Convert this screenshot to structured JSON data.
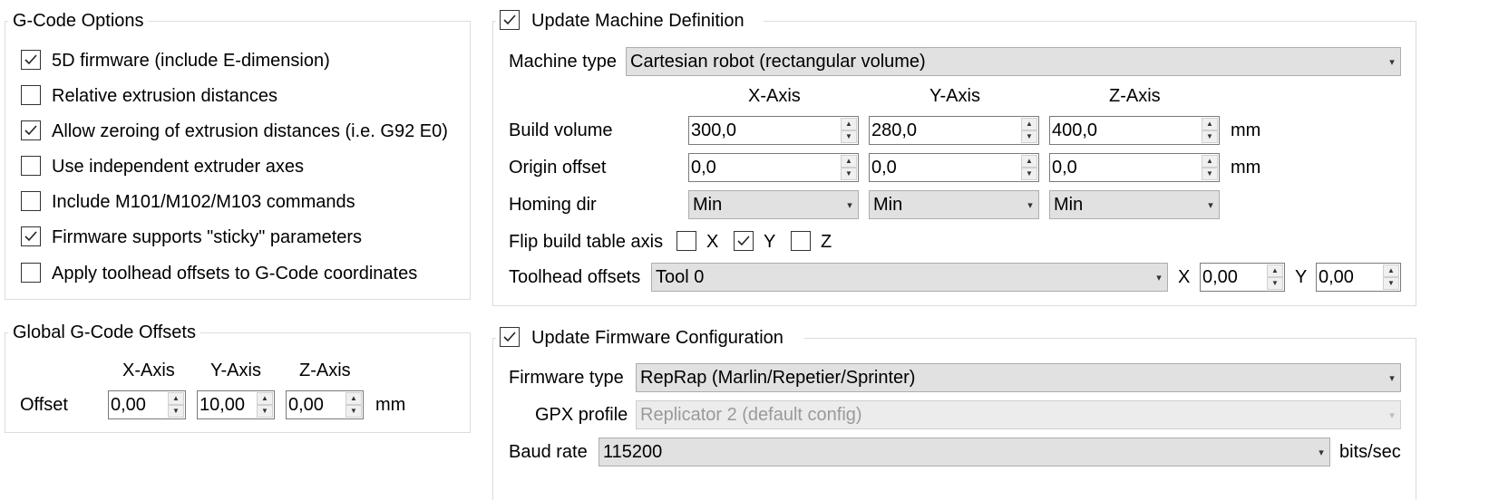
{
  "gcode_options": {
    "title": "G-Code Options",
    "items": [
      {
        "label": "5D firmware (include E-dimension)",
        "checked": true
      },
      {
        "label": "Relative extrusion distances",
        "checked": false
      },
      {
        "label": "Allow zeroing of extrusion distances (i.e. G92 E0)",
        "checked": true
      },
      {
        "label": "Use independent extruder axes",
        "checked": false
      },
      {
        "label": "Include M101/M102/M103 commands",
        "checked": false
      },
      {
        "label": "Firmware supports \"sticky\" parameters",
        "checked": true
      },
      {
        "label": "Apply toolhead offsets to G-Code coordinates",
        "checked": false
      }
    ]
  },
  "global_offsets": {
    "title": "Global G-Code Offsets",
    "x_header": "X-Axis",
    "y_header": "Y-Axis",
    "z_header": "Z-Axis",
    "offset_label": "Offset",
    "x": "0,00",
    "y": "10,00",
    "z": "0,00",
    "unit": "mm"
  },
  "machine_def": {
    "title": "Update Machine Definition",
    "enabled": true,
    "machine_type_label": "Machine type",
    "machine_type_value": "Cartesian robot (rectangular volume)",
    "x_header": "X-Axis",
    "y_header": "Y-Axis",
    "z_header": "Z-Axis",
    "build_volume_label": "Build volume",
    "build_volume": {
      "x": "300,0",
      "y": "280,0",
      "z": "400,0"
    },
    "origin_offset_label": "Origin offset",
    "origin_offset": {
      "x": "0,0",
      "y": "0,0",
      "z": "0,0"
    },
    "unit": "mm",
    "homing_label": "Homing dir",
    "homing": {
      "x": "Min",
      "y": "Min",
      "z": "Min"
    },
    "flip_label": "Flip build table axis",
    "flip": {
      "x": {
        "label": "X",
        "checked": false
      },
      "y": {
        "label": "Y",
        "checked": true
      },
      "z": {
        "label": "Z",
        "checked": false
      }
    },
    "toolhead_label": "Toolhead offsets",
    "toolhead_value": "Tool 0",
    "toolhead_x_label": "X",
    "toolhead_x": "0,00",
    "toolhead_y_label": "Y",
    "toolhead_y": "0,00"
  },
  "firmware_config": {
    "title": "Update Firmware Configuration",
    "enabled": true,
    "firmware_type_label": "Firmware type",
    "firmware_type_value": "RepRap (Marlin/Repetier/Sprinter)",
    "gpx_label": "GPX profile",
    "gpx_value": "Replicator 2 (default config)",
    "baud_label": "Baud rate",
    "baud_value": "115200",
    "baud_unit": "bits/sec"
  }
}
